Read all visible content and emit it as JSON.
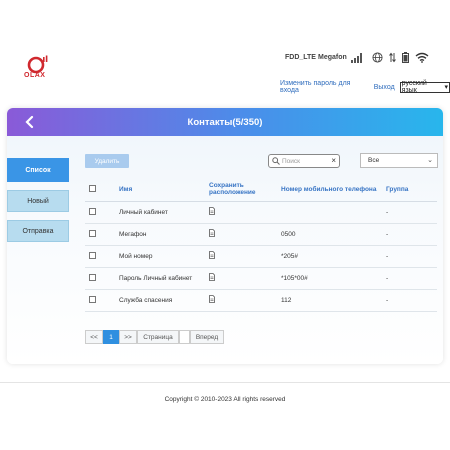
{
  "header": {
    "logo_text": "OLAX",
    "network_type": "FDD_LTE",
    "operator": "Megafon",
    "signal_strength": 4,
    "icons": [
      "signal-bars-icon",
      "globe-icon",
      "data-transfer-icon",
      "battery-icon",
      "wifi-icon"
    ]
  },
  "top_links": {
    "change_password": "Изменить пароль для входа",
    "logout": "Выход",
    "language": "русский язык"
  },
  "card": {
    "title": "Контакты(5/350)"
  },
  "side_tabs": [
    {
      "label": "Список",
      "active": true
    },
    {
      "label": "Новый",
      "active": false
    },
    {
      "label": "Отправка",
      "active": false
    }
  ],
  "toolbar": {
    "delete_label": "Удалить",
    "search_placeholder": "Поиск",
    "clear_label": "×",
    "filter_value": "Все"
  },
  "table": {
    "headers": {
      "name": "Имя",
      "save_location": "Сохранить расположение",
      "phone": "Номер мобильного телефона",
      "group": "Группа"
    },
    "rows": [
      {
        "name": "Личный кабинет",
        "phone": "",
        "group": "-"
      },
      {
        "name": "Мегафон",
        "phone": "0500",
        "group": "-"
      },
      {
        "name": "Мой номер",
        "phone": "*205#",
        "group": "-"
      },
      {
        "name": "Пароль Личный кабинет",
        "phone": "*105*00#",
        "group": "-"
      },
      {
        "name": "Служба спасения",
        "phone": "112",
        "group": "-"
      }
    ]
  },
  "pager": {
    "prev": "<<",
    "current": "1",
    "next": ">>",
    "page_label": "Страница",
    "go_label": "Вперед"
  },
  "footer": {
    "copyright": "Copyright © 2010-2023 All rights reserved"
  },
  "colors": {
    "brand_red": "#d0282e",
    "header_gradient_start": "#8a5ad8",
    "header_gradient_end": "#28b6ec",
    "active_tab": "#3a95e6",
    "link": "#2f6dbd"
  }
}
